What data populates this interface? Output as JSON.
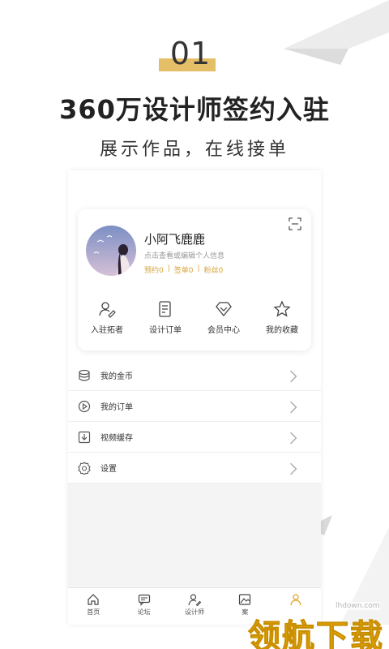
{
  "hero": {
    "number": "01",
    "headline": "360万设计师签约入驻",
    "subline": "展示作品，在线接单"
  },
  "profile": {
    "name": "小阿飞鹿鹿",
    "hint": "点击查看或编辑个人信息",
    "stats": [
      "预约0",
      "签单0",
      "粉丝0"
    ],
    "separator": "|"
  },
  "quick_actions": [
    {
      "label": "入驻拓者",
      "icon": "user-edit-icon"
    },
    {
      "label": "设计订单",
      "icon": "document-icon"
    },
    {
      "label": "会员中心",
      "icon": "diamond-icon"
    },
    {
      "label": "我的收藏",
      "icon": "star-icon"
    }
  ],
  "menu": [
    {
      "label": "我的金币",
      "icon": "coins-icon"
    },
    {
      "label": "我的订单",
      "icon": "play-circle-icon"
    },
    {
      "label": "视频缓存",
      "icon": "download-icon"
    },
    {
      "label": "设置",
      "icon": "gear-icon"
    }
  ],
  "tabbar": [
    {
      "label": "首页",
      "icon": "home-icon"
    },
    {
      "label": "论坛",
      "icon": "chat-icon"
    },
    {
      "label": "设计师",
      "icon": "designer-icon"
    },
    {
      "label": "案",
      "icon": "image-icon"
    },
    {
      "label": "",
      "icon": "person-icon"
    }
  ],
  "watermark": {
    "url": "lhdown.com",
    "text": "领航下载"
  },
  "colors": {
    "accent": "#e4bf67",
    "stats": "#d9a43a",
    "watermark": "#f2b400"
  }
}
